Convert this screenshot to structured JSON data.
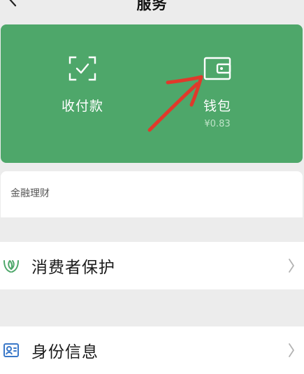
{
  "nav": {
    "title": "服务",
    "back_icon": "chevron-left-icon"
  },
  "pay_card": {
    "background": "#4ea76a",
    "collect": {
      "label": "收付款",
      "icon": "scan-check-icon"
    },
    "wallet": {
      "label": "钱包",
      "balance": "¥0.83",
      "icon": "wallet-icon"
    }
  },
  "finance": {
    "title": "金融理财"
  },
  "list": [
    {
      "label": "消费者保护",
      "icon": "hands-leaf-icon"
    },
    {
      "label": "身份信息",
      "icon": "id-card-icon"
    }
  ],
  "colors": {
    "accent_green": "#4ea76a",
    "annotation_red": "#e0392b",
    "page_bg": "#ececec"
  }
}
